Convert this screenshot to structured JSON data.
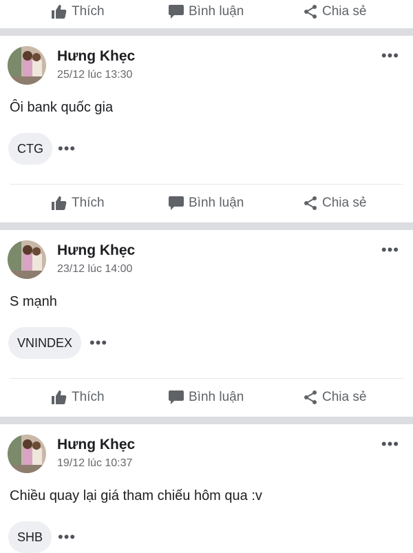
{
  "actions": {
    "like": "Thích",
    "comment": "Bình luận",
    "share": "Chia sẻ"
  },
  "more_glyph": "•••",
  "posts": [
    {
      "author": "Hưng Khẹc",
      "time": "25/12 lúc 13:30",
      "text": "Ôi bank quốc gia",
      "tag": "CTG"
    },
    {
      "author": "Hưng Khẹc",
      "time": "23/12 lúc 14:00",
      "text": "S mạnh",
      "tag": "VNINDEX"
    },
    {
      "author": "Hưng Khẹc",
      "time": "19/12 lúc 10:37",
      "text": "Chiều quay lại giá tham chiếu hôm qua :v",
      "tag": "SHB"
    }
  ]
}
